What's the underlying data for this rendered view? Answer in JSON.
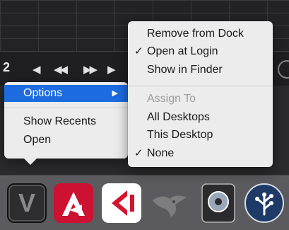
{
  "app_window": {
    "counter_text": "2",
    "transport_buttons": [
      "◀",
      "◀◀",
      "▶▶",
      "▶"
    ]
  },
  "options_menu": {
    "options_label": "Options",
    "options_arrow": "▶",
    "show_recents_label": "Show Recents",
    "open_label": "Open"
  },
  "submenu": {
    "remove_from_dock": "Remove from Dock",
    "open_at_login": "Open at Login",
    "show_in_finder": "Show in Finder",
    "assign_to_heading": "Assign To",
    "all_desktops": "All Desktops",
    "this_desktop": "This Desktop",
    "none": "None",
    "checkmark": "✓"
  },
  "dock": {
    "v_icon_letter": "V",
    "icons": [
      "vst-v-icon",
      "red-arrow-app-icon",
      "cubase-icon",
      "eagle-icon",
      "logic-pro-icon",
      "sourcetree-icon"
    ]
  },
  "colors": {
    "highlight": "#1c6ce0",
    "menu_bg": "#ececec",
    "dock_bg": "#5b5b5f"
  }
}
